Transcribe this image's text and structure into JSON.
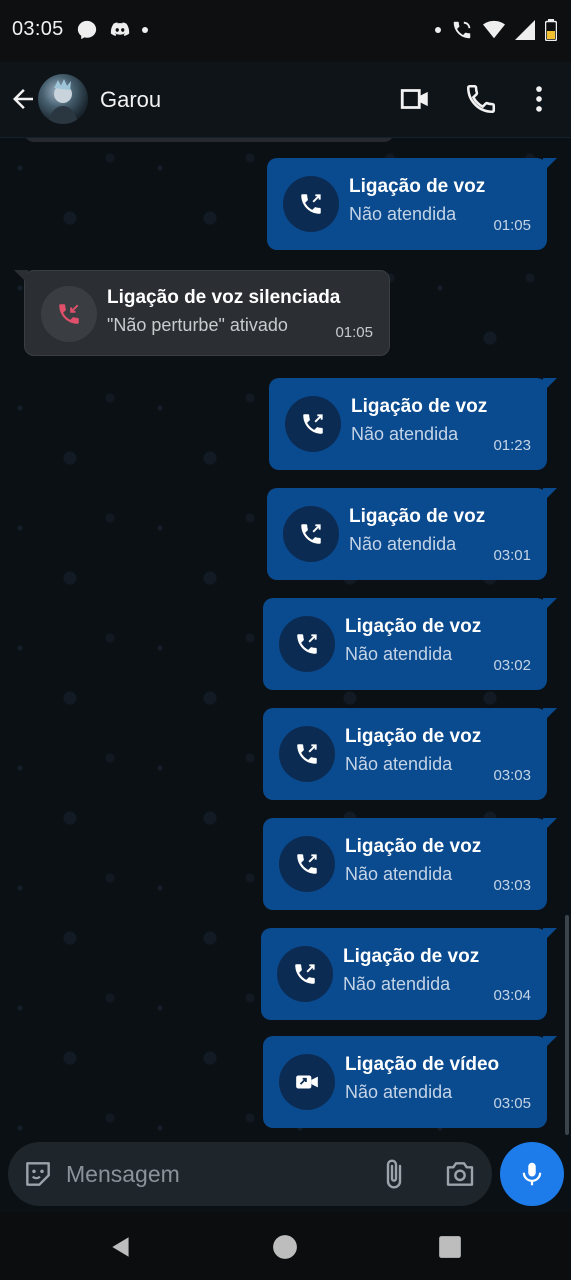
{
  "status_bar": {
    "time": "03:05",
    "left_icons": [
      "messenger-icon",
      "discord-icon",
      "notification-dot-icon"
    ],
    "right_icons": [
      "notification-dot-icon",
      "wifi-call-icon",
      "wifi-icon",
      "signal-icon",
      "battery-icon"
    ]
  },
  "header": {
    "contact_name": "Garou",
    "actions": [
      "video-call-icon",
      "voice-call-icon",
      "more-vert-icon"
    ]
  },
  "messages": [
    {
      "direction": "out",
      "call_type": "voice",
      "title": "Ligação de voz",
      "subtitle": "Não atendida",
      "time": "01:05"
    },
    {
      "direction": "in",
      "call_type": "voice-silenced",
      "title": "Ligação de voz silenciada",
      "subtitle": "\"Não perturbe\" ativado",
      "time": "01:05"
    },
    {
      "direction": "out",
      "call_type": "voice",
      "title": "Ligação de voz",
      "subtitle": "Não atendida",
      "time": "01:23"
    },
    {
      "direction": "out",
      "call_type": "voice",
      "title": "Ligação de voz",
      "subtitle": "Não atendida",
      "time": "03:01"
    },
    {
      "direction": "out",
      "call_type": "voice",
      "title": "Ligação de voz",
      "subtitle": "Não atendida",
      "time": "03:02"
    },
    {
      "direction": "out",
      "call_type": "voice",
      "title": "Ligação de voz",
      "subtitle": "Não atendida",
      "time": "03:03"
    },
    {
      "direction": "out",
      "call_type": "voice",
      "title": "Ligação de voz",
      "subtitle": "Não atendida",
      "time": "03:03"
    },
    {
      "direction": "out",
      "call_type": "voice",
      "title": "Ligação de voz",
      "subtitle": "Não atendida",
      "time": "03:04"
    },
    {
      "direction": "out",
      "call_type": "video",
      "title": "Ligação de vídeo",
      "subtitle": "Não atendida",
      "time": "03:05"
    }
  ],
  "composer": {
    "placeholder": "Mensagem",
    "value": ""
  },
  "colors": {
    "outgoing_bubble": "#0a4a8e",
    "incoming_bubble": "#2b2f33",
    "mic_button": "#1d7bea",
    "missed_call_red": "#e0506a"
  }
}
